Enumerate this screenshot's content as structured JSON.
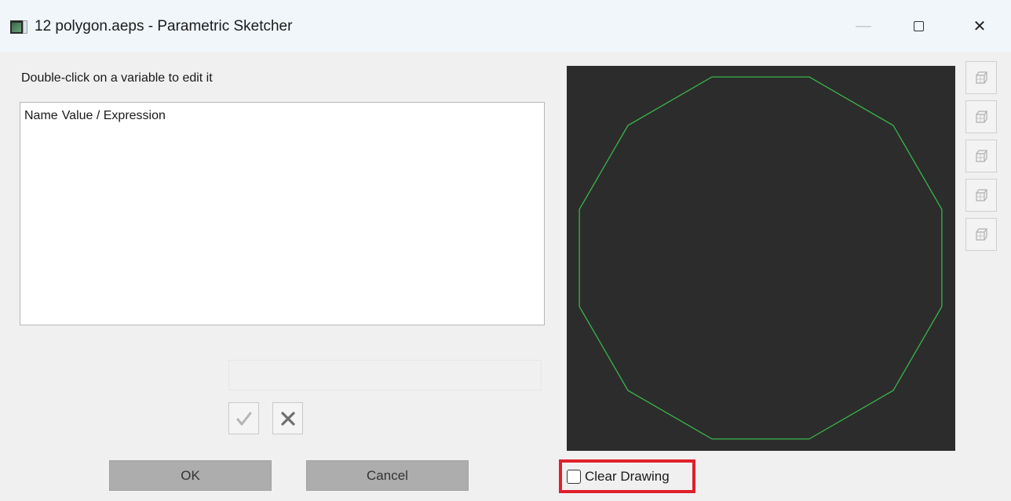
{
  "window": {
    "title": "12 polygon.aeps - Parametric Sketcher",
    "minimize_glyph": "—",
    "close_glyph": "✕"
  },
  "editor": {
    "hint": "Double-click on a variable to edit it",
    "columns": [
      "Name",
      "Value / Expression"
    ],
    "expression_value": "",
    "accept_icon": "checkmark-icon",
    "reject_icon": "x-icon"
  },
  "buttons": {
    "ok": "OK",
    "cancel": "Cancel"
  },
  "sketch": {
    "background": "#2c2c2c",
    "stroke": "#39b54a",
    "sides": 12
  },
  "view_buttons": [
    "cube-view-icon",
    "cube-view-icon",
    "cube-view-icon",
    "cube-view-icon",
    "cube-view-icon"
  ],
  "options": {
    "clear_drawing_label": "Clear Drawing",
    "clear_drawing_checked": false,
    "highlight_color": "#e0202a"
  }
}
